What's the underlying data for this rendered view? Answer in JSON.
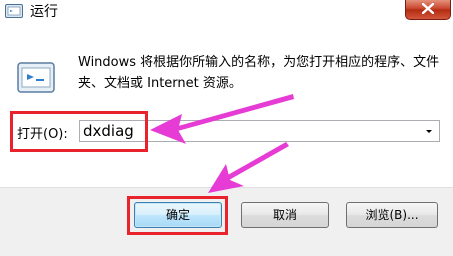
{
  "window": {
    "title": "运行",
    "close_icon": "close-icon"
  },
  "dialog": {
    "description": "Windows 将根据你所输入的名称，为您打开相应的程序、文件夹、文档或 Internet 资源。",
    "open_label": "打开(O):",
    "open_value": "dxdiag"
  },
  "buttons": {
    "ok": "确定",
    "cancel": "取消",
    "browse": "浏览(B)..."
  },
  "annotations": {
    "highlight_color": "#e8232b",
    "arrow_color": "#e63bd4"
  }
}
